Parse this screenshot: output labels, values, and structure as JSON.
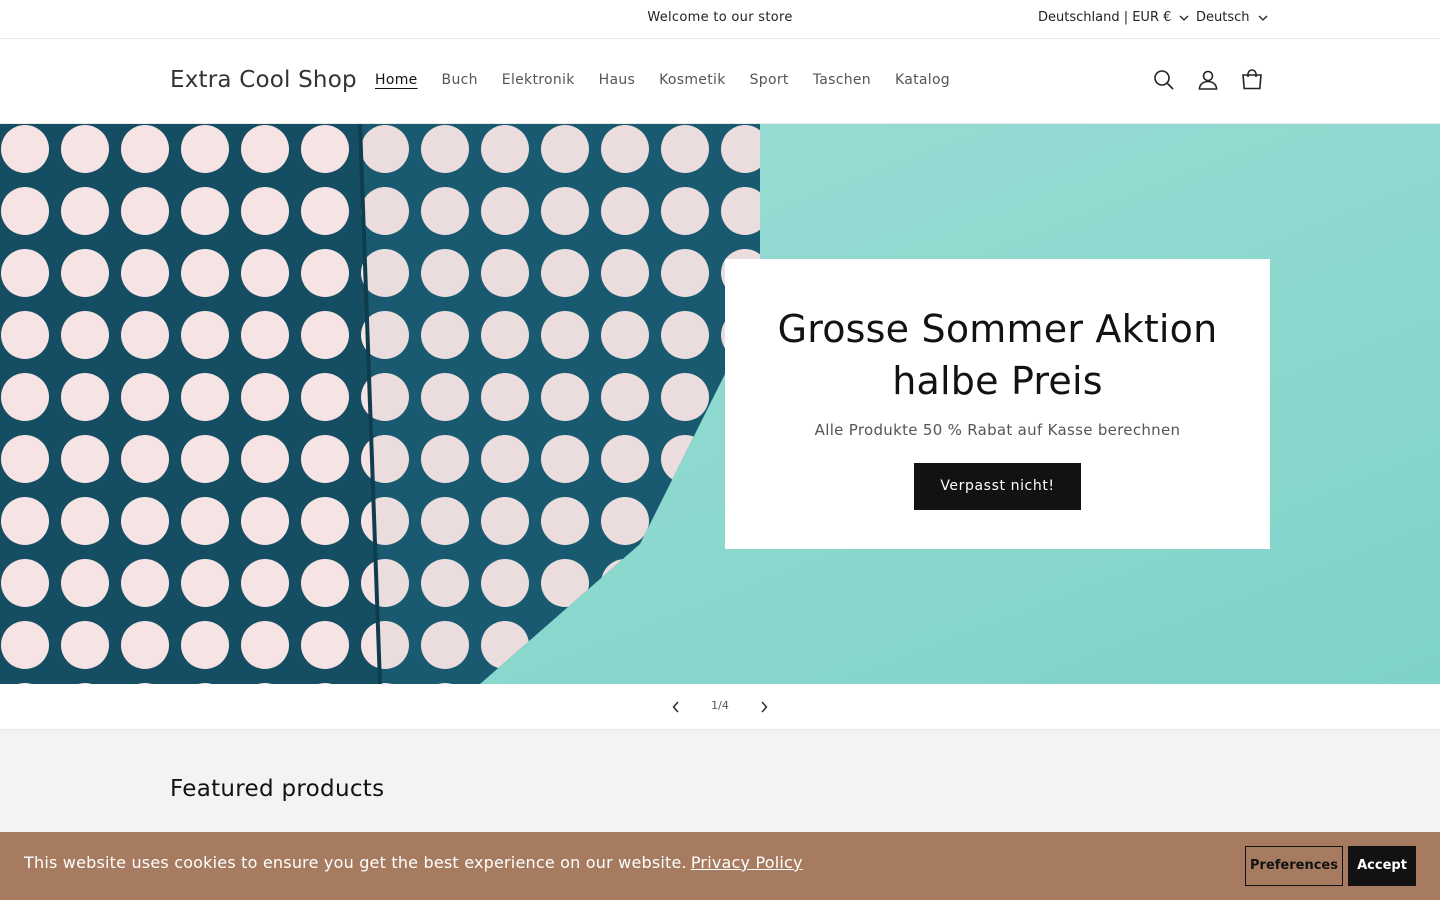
{
  "announcement": {
    "text": "Welcome to our store",
    "country": "Deutschland | EUR €",
    "language": "Deutsch"
  },
  "header": {
    "logo": "Extra Cool Shop",
    "nav": [
      "Home",
      "Buch",
      "Elektronik",
      "Haus",
      "Kosmetik",
      "Sport",
      "Taschen",
      "Katalog"
    ],
    "active_nav": "Home",
    "icons": [
      "search-icon",
      "account-icon",
      "cart-icon"
    ]
  },
  "hero": {
    "title_line1": "Grosse Sommer Aktion",
    "title_line2": "halbe Preis",
    "subtitle": "Alle Produkte 50 % Rabat auf Kasse berechnen",
    "button": "Verpasst nicht!"
  },
  "slider": {
    "counter": "1/4",
    "current": 1,
    "total": 4
  },
  "featured": {
    "title": "Featured products"
  },
  "cookie_banner": {
    "text": "This website uses cookies to ensure you get the best experience on our website.",
    "link": "Privacy Policy",
    "preferences": "Preferences",
    "accept": "Accept"
  },
  "colors": {
    "hero_background": "#8fd9cf",
    "bag_navy": "#154e63",
    "gift_card_red": "#f26060",
    "cookie_banner": "#a67b5f",
    "button_dark": "#121212"
  }
}
